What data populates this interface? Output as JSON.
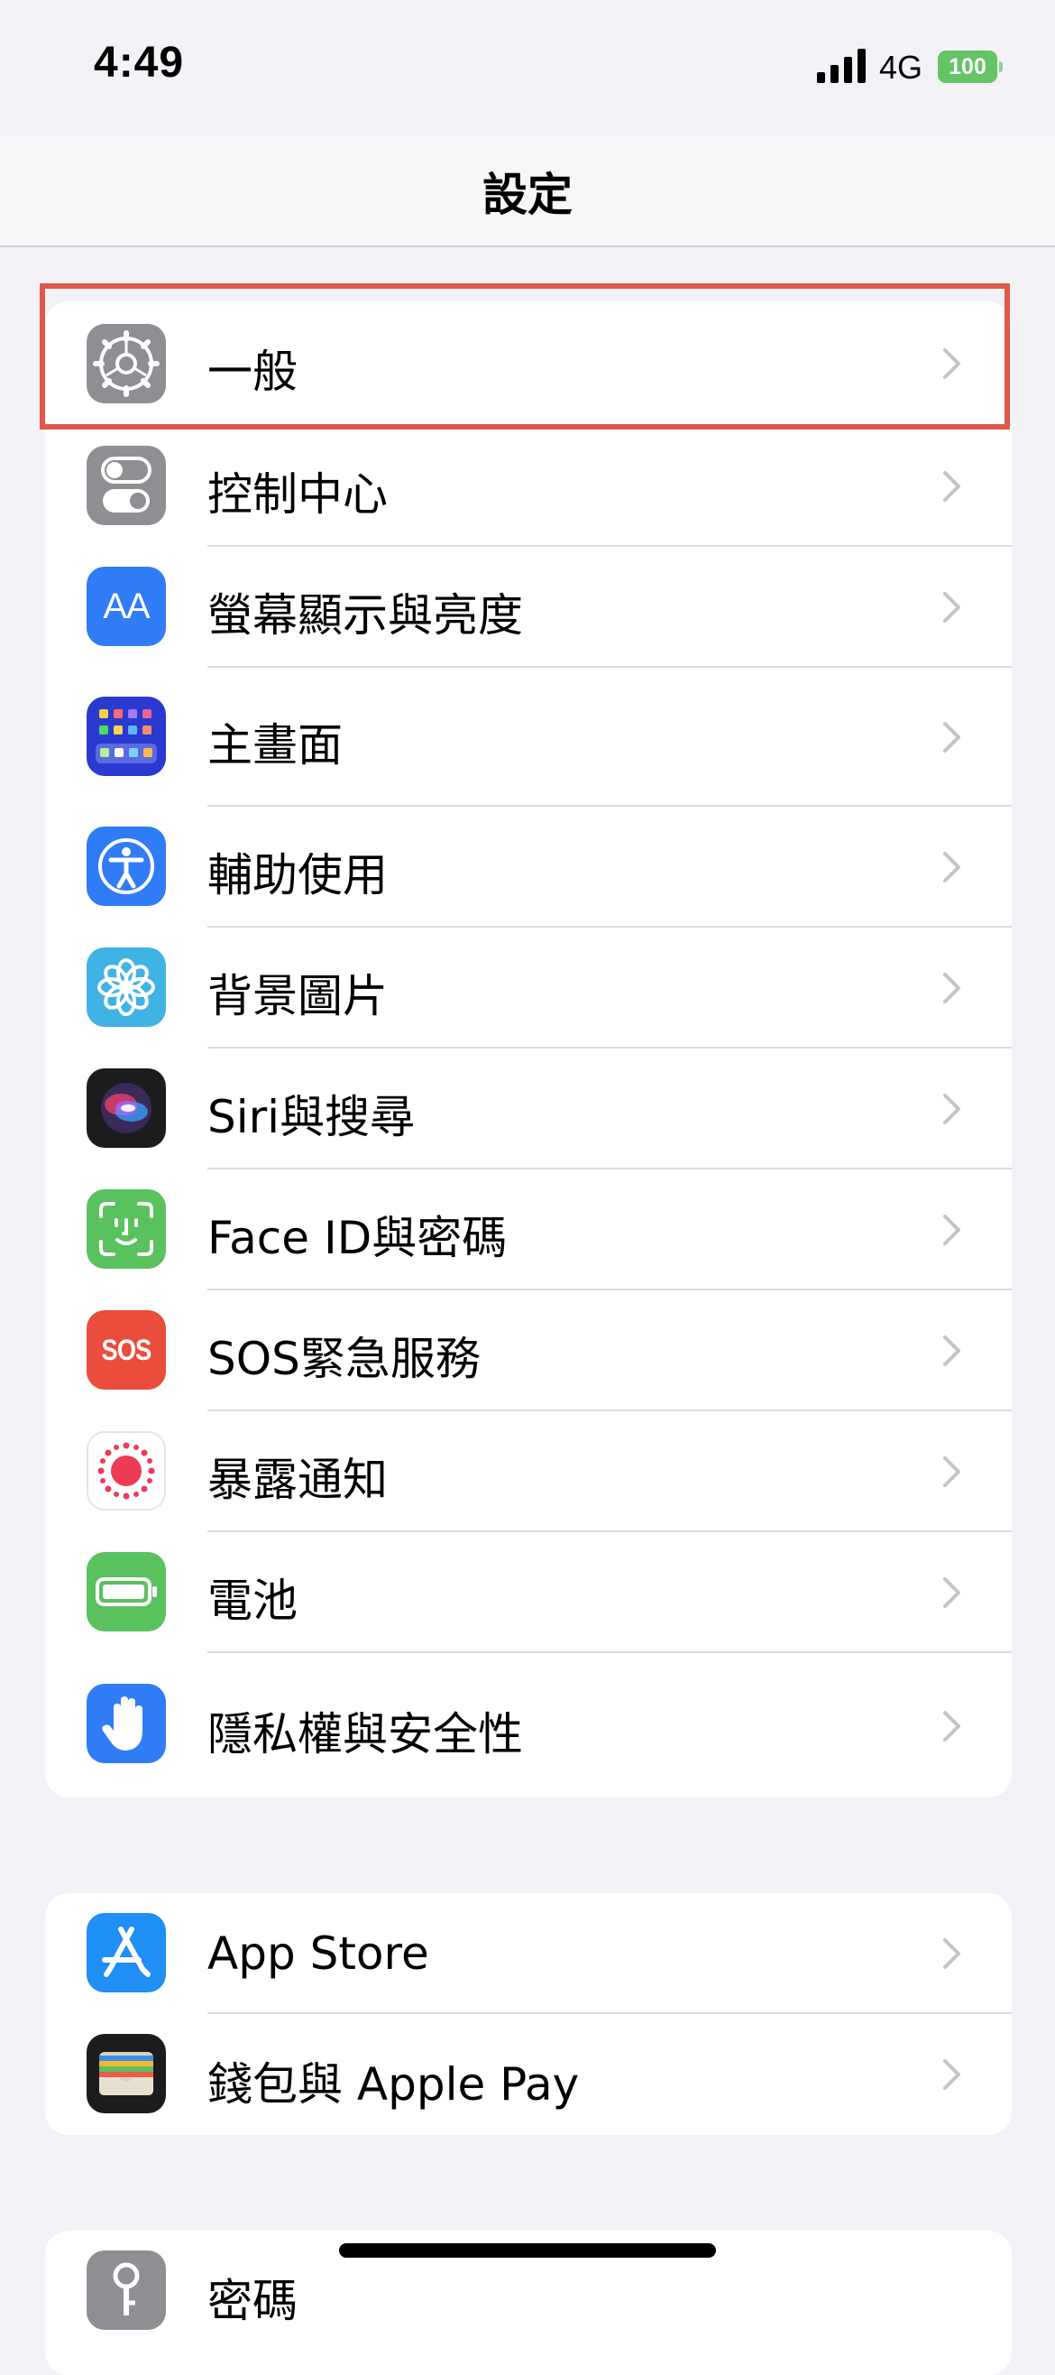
{
  "status_bar": {
    "time": "4:49",
    "network": "4G",
    "battery": "100"
  },
  "nav": {
    "title": "設定"
  },
  "sections": [
    {
      "items": [
        {
          "label": "一般",
          "icon": "gear-icon",
          "color": "#8e8e93"
        },
        {
          "label": "控制中心",
          "icon": "toggles-icon",
          "color": "#8e8e93"
        },
        {
          "label": "螢幕顯示與亮度",
          "icon": "text-size-icon",
          "icon_text": "AA",
          "color": "#2f7cf6"
        },
        {
          "label": "主畫面",
          "icon": "home-screen-icon",
          "color": "#2a3ad0"
        },
        {
          "label": "輔助使用",
          "icon": "accessibility-icon",
          "color": "#2f7cf6"
        },
        {
          "label": "背景圖片",
          "icon": "wallpaper-flower-icon",
          "color": "#40b3e5"
        },
        {
          "label": "Siri與搜尋",
          "icon": "siri-icon",
          "color": "#222222"
        },
        {
          "label": "Face ID與密碼",
          "icon": "face-id-icon",
          "color": "#5ac15f"
        },
        {
          "label": "SOS緊急服務",
          "icon": "sos-icon",
          "icon_text": "SOS",
          "color": "#eb4d3d"
        },
        {
          "label": "暴露通知",
          "icon": "exposure-icon",
          "color": "#ffffff"
        },
        {
          "label": "電池",
          "icon": "battery-icon",
          "color": "#5ac15f"
        },
        {
          "label": "隱私權與安全性",
          "icon": "hand-icon",
          "color": "#2f7cf6"
        }
      ]
    },
    {
      "items": [
        {
          "label": "App Store",
          "icon": "app-store-icon",
          "color": "#1f8ef5"
        },
        {
          "label": "錢包與 Apple Pay",
          "icon": "wallet-icon",
          "color": "#1c1c1e"
        }
      ]
    },
    {
      "items": [
        {
          "label": "密碼",
          "icon": "key-icon",
          "color": "#8e8e93"
        }
      ]
    }
  ],
  "highlight": {
    "color": "#e0584c"
  }
}
